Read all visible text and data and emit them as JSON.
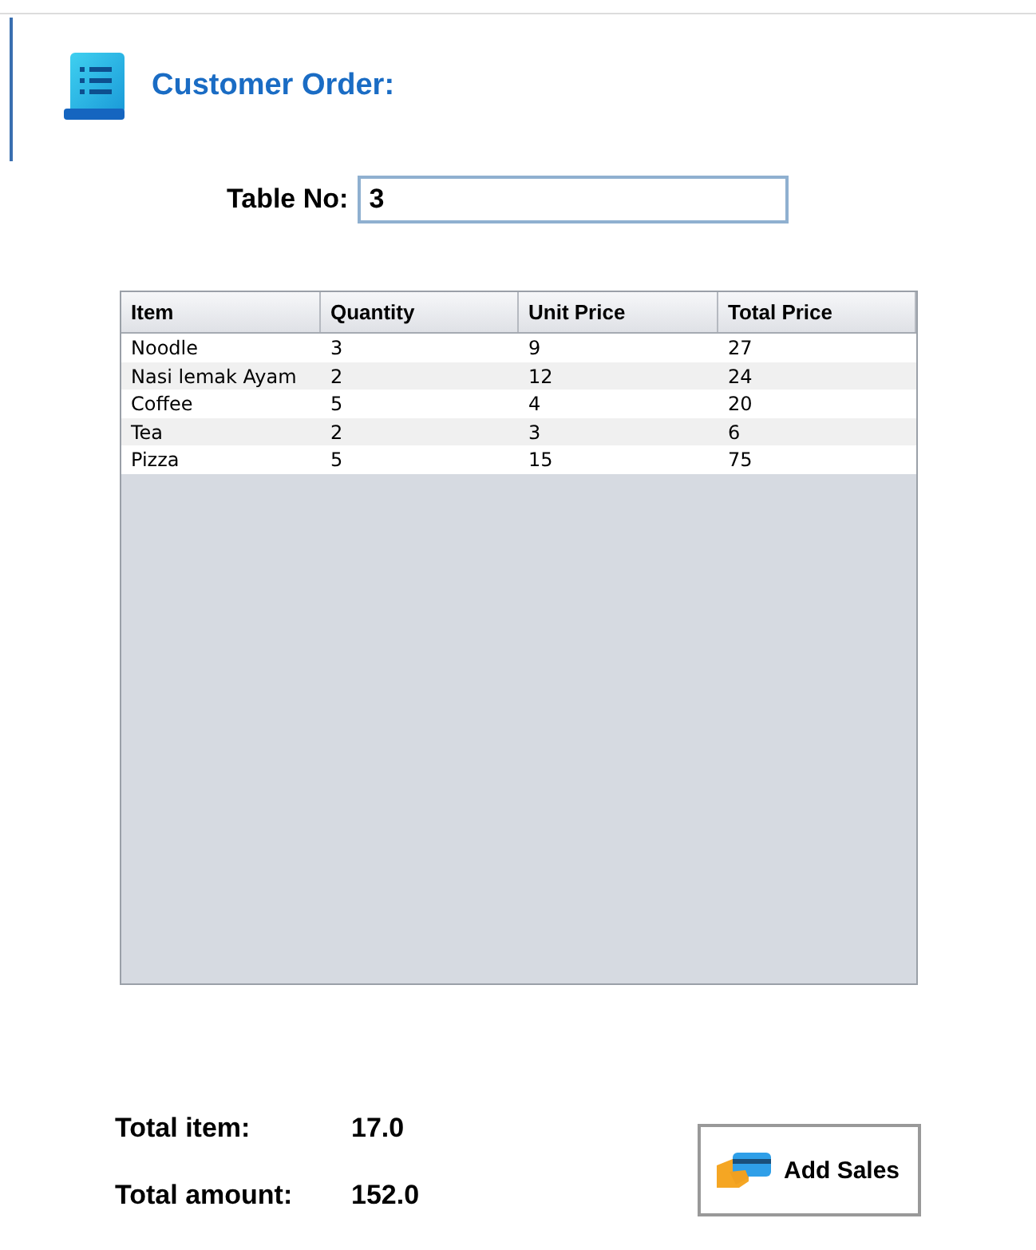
{
  "header": {
    "title": "Customer Order:"
  },
  "table_no": {
    "label": "Table No:",
    "value": "3"
  },
  "table": {
    "columns": [
      "Item",
      "Quantity",
      "Unit Price",
      "Total Price"
    ],
    "rows": [
      [
        "Noodle",
        "3",
        "9",
        "27"
      ],
      [
        "Nasi lemak Ayam",
        "2",
        "12",
        "24"
      ],
      [
        "Coffee",
        "5",
        "4",
        "20"
      ],
      [
        "Tea",
        "2",
        "3",
        "6"
      ],
      [
        "Pizza",
        "5",
        "15",
        "75"
      ]
    ]
  },
  "totals": [
    {
      "label": "Total item:",
      "value": "17.0"
    },
    {
      "label": "Total amount:",
      "value": "152.0"
    }
  ],
  "add_button": {
    "label": "Add Sales"
  }
}
